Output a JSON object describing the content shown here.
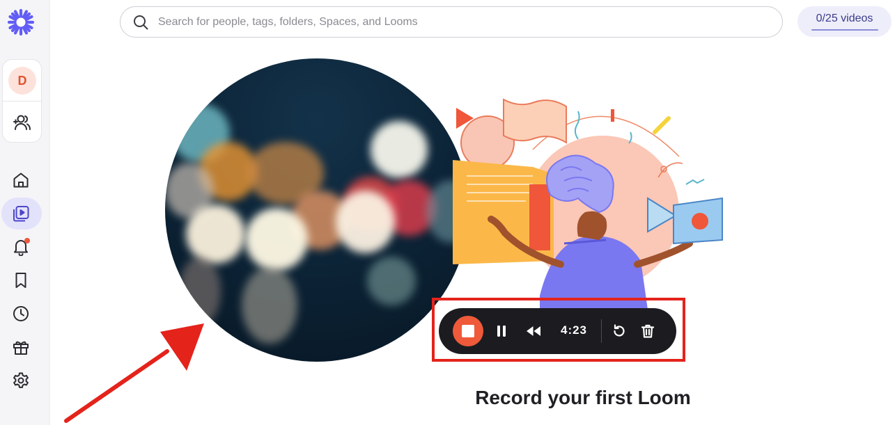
{
  "search": {
    "placeholder": "Search for people, tags, folders, Spaces, and Looms"
  },
  "quota": {
    "label": "0/25 videos"
  },
  "workspace": {
    "avatar_initial": "D"
  },
  "sidebar": {
    "items": [
      {
        "id": "home",
        "icon": "home-icon"
      },
      {
        "id": "library",
        "icon": "video-library-icon",
        "active": true
      },
      {
        "id": "notifications",
        "icon": "bell-icon",
        "has_badge": true
      },
      {
        "id": "bookmarks",
        "icon": "bookmark-icon"
      },
      {
        "id": "history",
        "icon": "clock-icon"
      },
      {
        "id": "gifts",
        "icon": "gift-icon"
      },
      {
        "id": "settings",
        "icon": "gear-icon"
      }
    ]
  },
  "recorder": {
    "timer": "4:23"
  },
  "main": {
    "headline": "Record your first Loom"
  },
  "colors": {
    "accent": "#625df5",
    "record": "#ee5a3a",
    "highlight": "#e4231b",
    "recorder_bg": "#1c1c20",
    "avatar_bg": "#fde2dc"
  }
}
